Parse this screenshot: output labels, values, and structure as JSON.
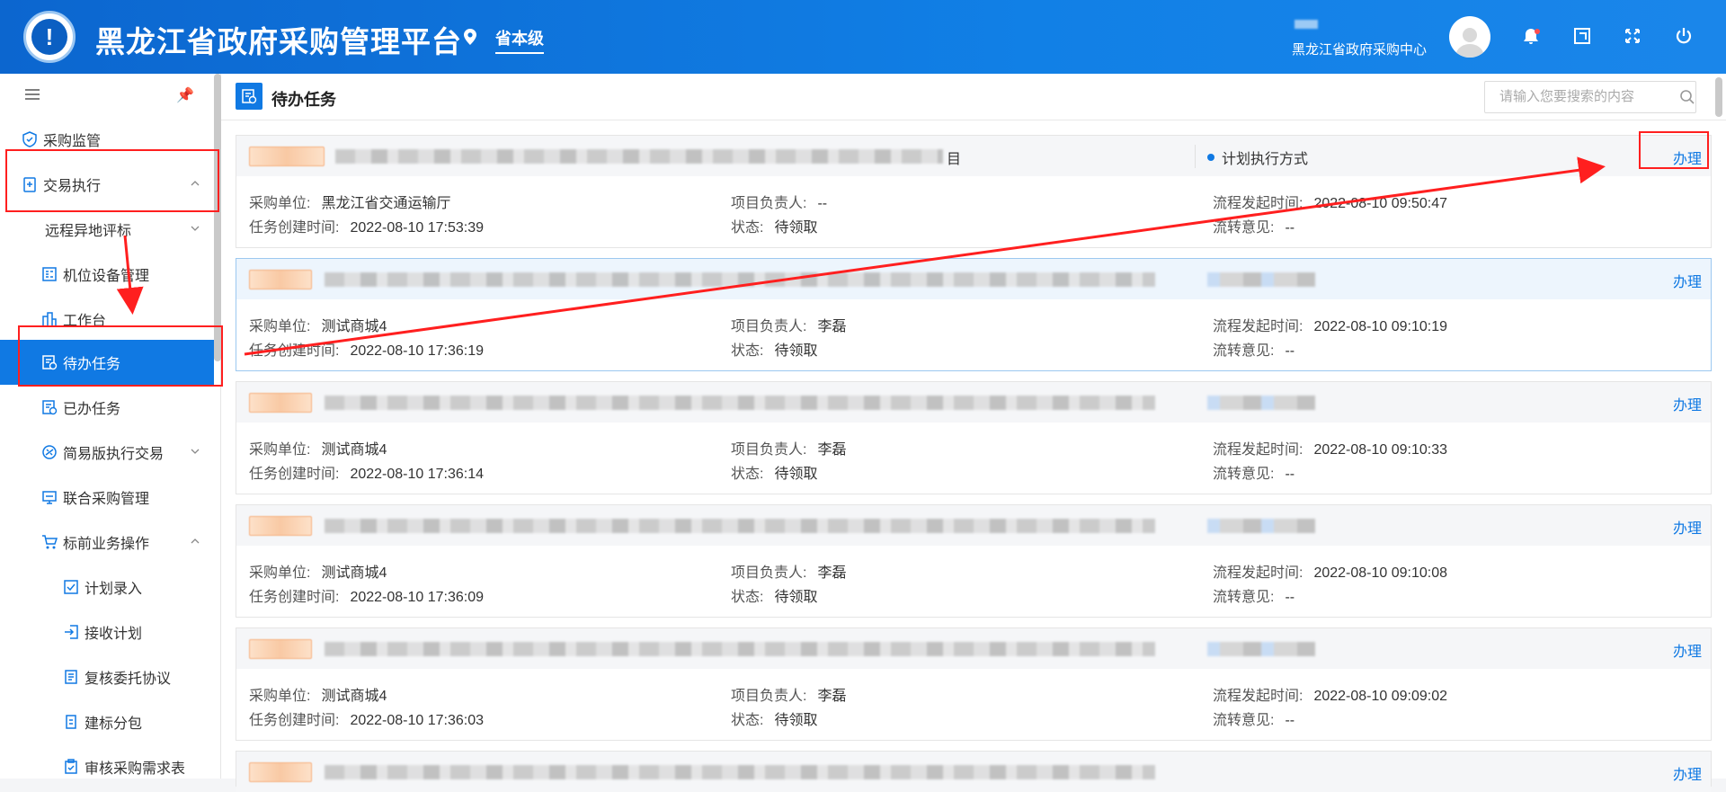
{
  "header": {
    "app_title": "黑龙江省政府采购管理平台",
    "location": "省本级",
    "user_org": "黑龙江省政府采购中心",
    "icons": [
      "location-pin-icon",
      "bell-icon",
      "window-icon",
      "fullscreen-icon",
      "power-icon"
    ]
  },
  "sidebar": {
    "items": [
      {
        "label": "采购监管",
        "icon": "shield-icon"
      },
      {
        "label": "交易执行",
        "icon": "clipboard-icon",
        "expanded": true
      },
      {
        "label": "远程异地评标"
      },
      {
        "label": "机位设备管理",
        "icon": "device-icon"
      },
      {
        "label": "工作台",
        "icon": "desk-icon"
      },
      {
        "label": "待办任务",
        "icon": "task-icon",
        "active": true
      },
      {
        "label": "已办任务",
        "icon": "done-task-icon"
      },
      {
        "label": "简易版执行交易",
        "icon": "simple-icon",
        "expanded": false
      },
      {
        "label": "联合采购管理",
        "icon": "joint-icon"
      },
      {
        "label": "标前业务操作",
        "icon": "cart-icon",
        "expanded": true
      },
      {
        "label": "计划录入",
        "icon": "check-doc-icon"
      },
      {
        "label": "接收计划",
        "icon": "receive-icon"
      },
      {
        "label": "复核委托协议",
        "icon": "agreement-icon"
      },
      {
        "label": "建标分包",
        "icon": "package-icon"
      },
      {
        "label": "审核采购需求表",
        "icon": "review-icon"
      }
    ]
  },
  "main": {
    "title": "待办任务",
    "search_placeholder": "请输入您要搜索的内容",
    "labels": {
      "unit": "采购单位:",
      "leader": "项目负责人:",
      "start_time": "流程发起时间:",
      "created": "任务创建时间:",
      "status": "状态:",
      "opinion": "流转意见:",
      "handle": "办理"
    },
    "tasks": [
      {
        "title_tail": "目",
        "exec": "计划执行方式",
        "unit": "黑龙江省交通运输厅",
        "leader": "--",
        "start_time": "2022-08-10 09:50:47",
        "created": "2022-08-10 17:53:39",
        "status": "待领取",
        "opinion": "--"
      },
      {
        "title_tail": "",
        "exec": "",
        "unit": "测试商城4",
        "leader": "李磊",
        "start_time": "2022-08-10 09:10:19",
        "created": "2022-08-10 17:36:19",
        "status": "待领取",
        "opinion": "--"
      },
      {
        "title_tail": "",
        "exec": "",
        "unit": "测试商城4",
        "leader": "李磊",
        "start_time": "2022-08-10 09:10:33",
        "created": "2022-08-10 17:36:14",
        "status": "待领取",
        "opinion": "--"
      },
      {
        "title_tail": "",
        "exec": "",
        "unit": "测试商城4",
        "leader": "李磊",
        "start_time": "2022-08-10 09:10:08",
        "created": "2022-08-10 17:36:09",
        "status": "待领取",
        "opinion": "--"
      },
      {
        "title_tail": "",
        "exec": "",
        "unit": "测试商城4",
        "leader": "李磊",
        "start_time": "2022-08-10 09:09:02",
        "created": "2022-08-10 17:36:03",
        "status": "待领取",
        "opinion": "--"
      }
    ]
  },
  "colors": {
    "header_blue": "#1180e6",
    "accent": "#1079e3",
    "annotation_red": "#ff1f1f"
  }
}
